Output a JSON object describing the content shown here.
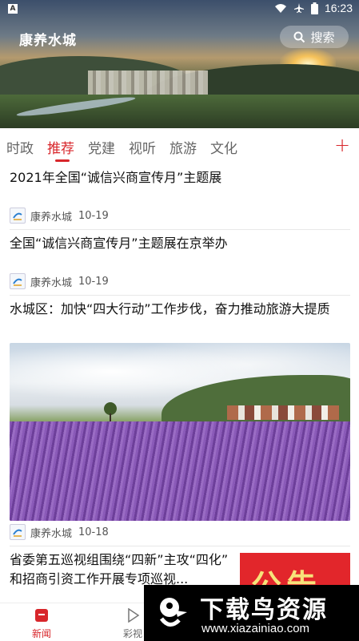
{
  "status_bar": {
    "time": "16:23"
  },
  "header": {
    "title": "康养水城",
    "search_label": "搜索"
  },
  "tabs": [
    {
      "label": "时政"
    },
    {
      "label": "推荐"
    },
    {
      "label": "党建"
    },
    {
      "label": "视听"
    },
    {
      "label": "旅游"
    },
    {
      "label": "文化"
    }
  ],
  "articles": [
    {
      "title": "2021年全国“诚信兴商宣传月”主题展",
      "source": "康养水城",
      "date": "10-19"
    },
    {
      "title": "全国“诚信兴商宣传月”主题展在京举办",
      "source": "康养水城",
      "date": "10-19"
    },
    {
      "title": "水城区：加快“四大行动”工作步伐，奋力推动旅游大提质",
      "source": "康养水城",
      "date": "10-18"
    },
    {
      "title": "省委第五巡视组围绕“四新”主攻“四化” 和招商引资工作开展专项巡视...",
      "thumb_text": "公告"
    }
  ],
  "bottom_nav": [
    {
      "label": "新闻"
    },
    {
      "label": "彩视"
    }
  ],
  "watermark": {
    "title": "下载鸟资源",
    "url": "www.xiazainiao.com"
  },
  "colors": {
    "accent": "#d8262b"
  }
}
